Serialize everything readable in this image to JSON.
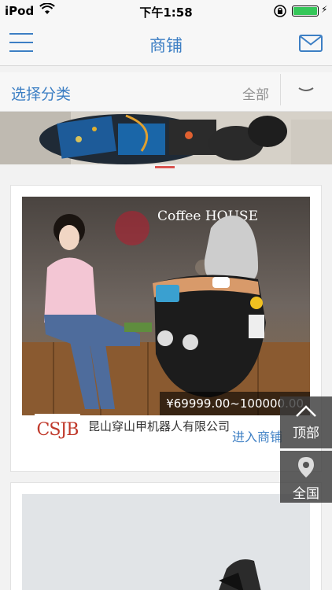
{
  "status_bar": {
    "carrier": "iPod",
    "time": "下午1:58"
  },
  "nav": {
    "title": "商铺",
    "menu_icon": "menu-icon",
    "mail_icon": "mail-icon"
  },
  "category": {
    "label": "选择分类",
    "selected": "全部"
  },
  "products": [
    {
      "price": "¥69999.00~100000.00",
      "logo_text": "CSJB",
      "company": "昆山穿山甲机器人有限公司",
      "enter_label": "进入商铺",
      "image_caption": "Coffee HOUSE"
    }
  ],
  "floating": {
    "top_label": "顶部",
    "all_label": "全国"
  },
  "colors": {
    "accent": "#3d7fc4",
    "banner_indicator": "#d9534f"
  }
}
